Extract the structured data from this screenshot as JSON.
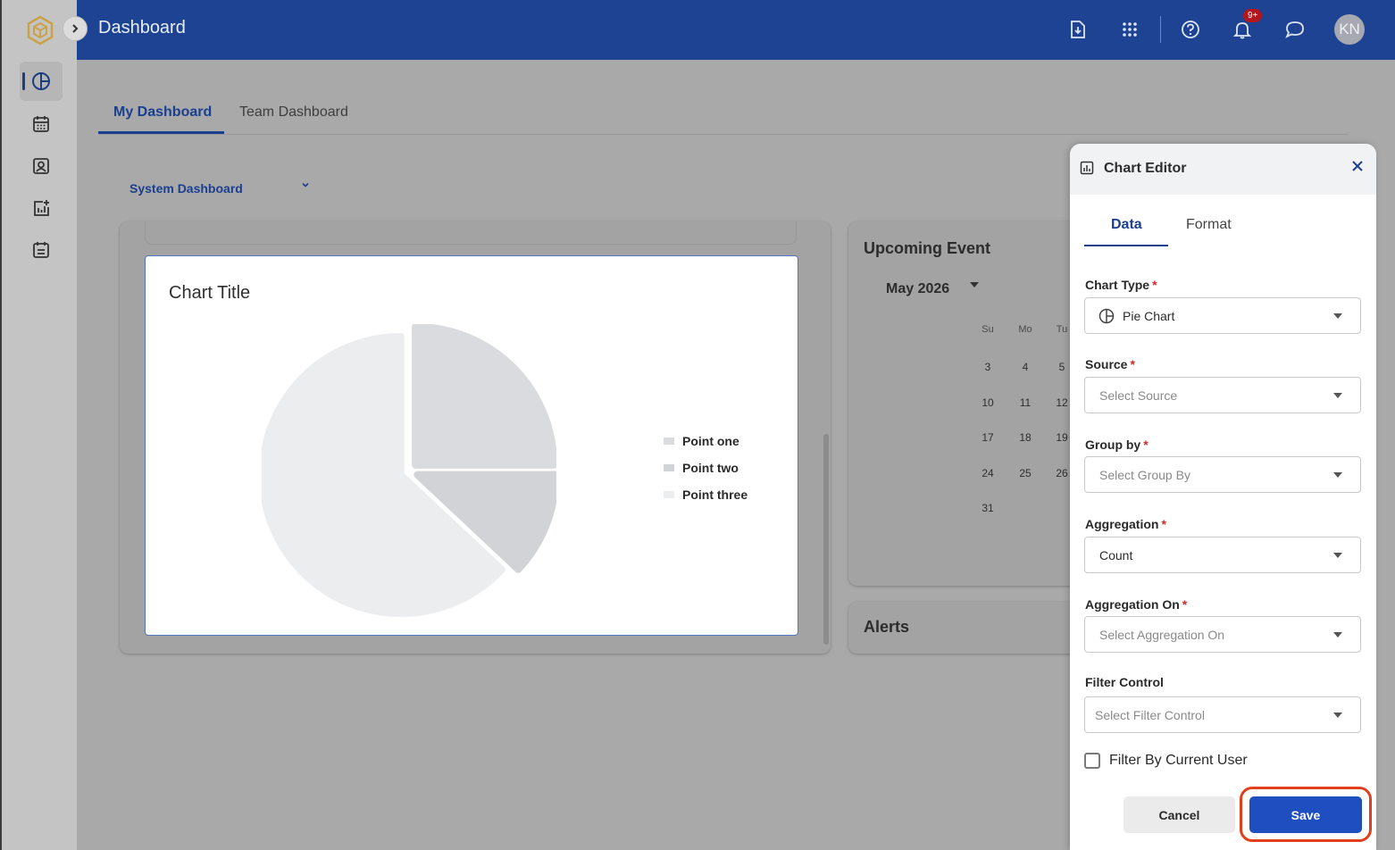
{
  "app": {
    "title": "Dashboard"
  },
  "topbar": {
    "notification_badge": "9+",
    "avatar_initials": "KN"
  },
  "tabs": [
    {
      "label": "My Dashboard"
    },
    {
      "label": "Team Dashboard"
    }
  ],
  "dashboard_selector": {
    "value": "System Dashboard"
  },
  "chart_widget": {
    "title": "Chart Title",
    "chart_data": {
      "type": "pie",
      "categories": [
        "Point one",
        "Point two",
        "Point three"
      ],
      "values": [
        25,
        12,
        63
      ],
      "title": "Chart Title",
      "legend": "right",
      "colors": [
        "#dadbde",
        "#d1d3d7",
        "#ecedef"
      ]
    }
  },
  "upcoming_event": {
    "title": "Upcoming Event",
    "month": "May 2026",
    "weekday_headers": [
      "Su",
      "Mo",
      "Tu"
    ],
    "rows": [
      [
        "",
        "",
        ""
      ],
      [
        "3",
        "4",
        "5"
      ],
      [
        "10",
        "11",
        "12"
      ],
      [
        "17",
        "18",
        "19"
      ],
      [
        "24",
        "25",
        "26"
      ],
      [
        "31",
        "",
        ""
      ]
    ]
  },
  "alerts": {
    "title": "Alerts"
  },
  "chart_editor": {
    "title": "Chart Editor",
    "tabs": [
      "Data",
      "Format"
    ],
    "fields": {
      "chart_type": {
        "label": "Chart Type",
        "value": "Pie Chart"
      },
      "source": {
        "label": "Source",
        "placeholder": "Select Source"
      },
      "group_by": {
        "label": "Group by",
        "placeholder": "Select Group By"
      },
      "aggregation": {
        "label": "Aggregation",
        "value": "Count"
      },
      "aggregation_on": {
        "label": "Aggregation On",
        "placeholder": "Select Aggregation On"
      },
      "filter_control": {
        "label": "Filter Control",
        "placeholder": "Select Filter Control"
      }
    },
    "required_marker": "*",
    "checkbox_label": "Filter By Current User",
    "cancel_label": "Cancel",
    "save_label": "Save"
  }
}
